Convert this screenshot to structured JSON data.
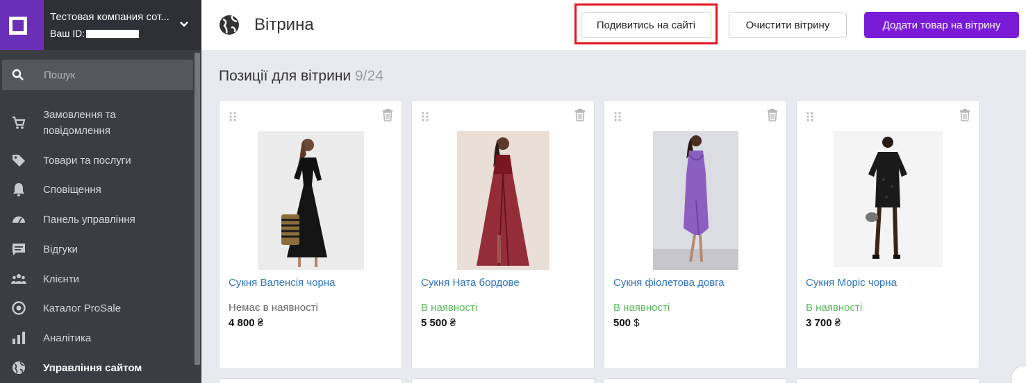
{
  "sidebar": {
    "company_name": "Тестовая компания сот...",
    "your_id_label": "Ваш ID:",
    "search_placeholder": "Пошук",
    "items": [
      {
        "label": "Замовлення та повідомлення",
        "icon": "cart-icon"
      },
      {
        "label": "Товари та послуги",
        "icon": "tag-icon"
      },
      {
        "label": "Сповіщення",
        "icon": "bell-icon"
      },
      {
        "label": "Панель управління",
        "icon": "dashboard-icon"
      },
      {
        "label": "Відгуки",
        "icon": "comment-icon"
      },
      {
        "label": "Клієнти",
        "icon": "people-icon"
      },
      {
        "label": "Каталог ProSale",
        "icon": "target-icon"
      },
      {
        "label": "Аналітика",
        "icon": "bar-chart-icon"
      },
      {
        "label": "Управління сайтом",
        "icon": "globe-icon",
        "active": true
      }
    ]
  },
  "header": {
    "title": "Вітрина",
    "view_button": "Подивитись на сайті",
    "clear_button": "Очистити вітрину",
    "add_button": "Додати товар на вітрину"
  },
  "section": {
    "title": "Позиції для вітрини",
    "count": "9/24"
  },
  "products": [
    {
      "name": "Сукня Валенсія чорна",
      "status": "Немає в наявності",
      "in_stock": false,
      "price": "4 800",
      "currency": "₴"
    },
    {
      "name": "Сукня Ната бордове",
      "status": "В наявності",
      "in_stock": true,
      "price": "5 500",
      "currency": "₴"
    },
    {
      "name": "Сукня фіолетова довга",
      "status": "В наявності",
      "in_stock": true,
      "price": "500",
      "currency": "$"
    },
    {
      "name": "Сукня Моріс чорна",
      "status": "В наявності",
      "in_stock": true,
      "price": "3 700",
      "currency": "₴"
    }
  ],
  "colors": {
    "accent": "#7a1bd8",
    "link": "#2f74c0",
    "in_stock": "#5cb85c",
    "highlight": "#e3151e",
    "sidebar": "#3c3d42"
  }
}
